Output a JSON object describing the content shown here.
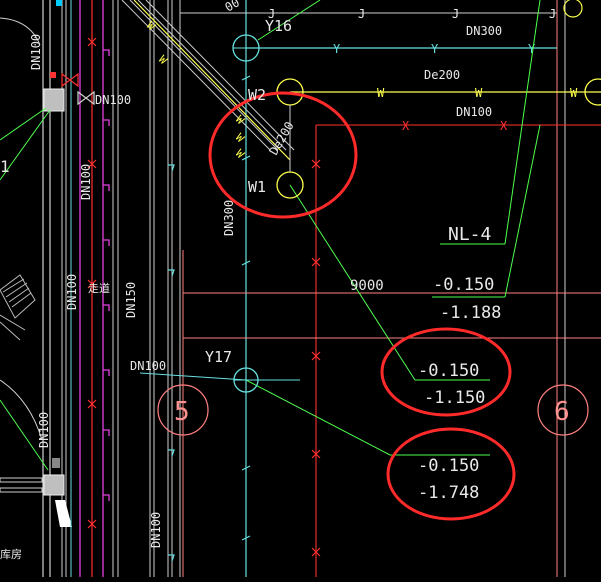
{
  "drawing": {
    "pipe_labels": {
      "dn100_top": "DN100",
      "dn100_valve": "DN100",
      "dn100_left_mid": "DN100",
      "dn100_left_lower": "DN100",
      "dn100_left_bottom": "DN100",
      "dn100_mid_left": "DN100",
      "dn100_bottom": "DN100",
      "dn100_red_line": "DN100",
      "dn150": "DN150",
      "dn300_top": "DN300",
      "dn300_vertical": "DN300",
      "de200_top": "De200",
      "de200_diagonal": "De200",
      "corridor": "走道",
      "left_bottom_char": "库房",
      "left_mid_char": "1",
      "top_corner": "00"
    },
    "line_codes": {
      "water": "W",
      "yellow": "Y",
      "rain": "J",
      "red": "X"
    },
    "nodes": {
      "y16": "Y16",
      "y17": "Y17",
      "w2": "W2",
      "w1": "W1",
      "nl4": "NL-4"
    },
    "dimension": "9000",
    "axis_labels": {
      "axis5": "5",
      "axis6": "6"
    },
    "elevations": [
      {
        "top": "-0.150",
        "bottom": "-1.188",
        "circled": false
      },
      {
        "top": "-0.150",
        "bottom": "-1.150",
        "circled": true
      },
      {
        "top": "-0.150",
        "bottom": "-1.748",
        "circled": true
      }
    ]
  }
}
